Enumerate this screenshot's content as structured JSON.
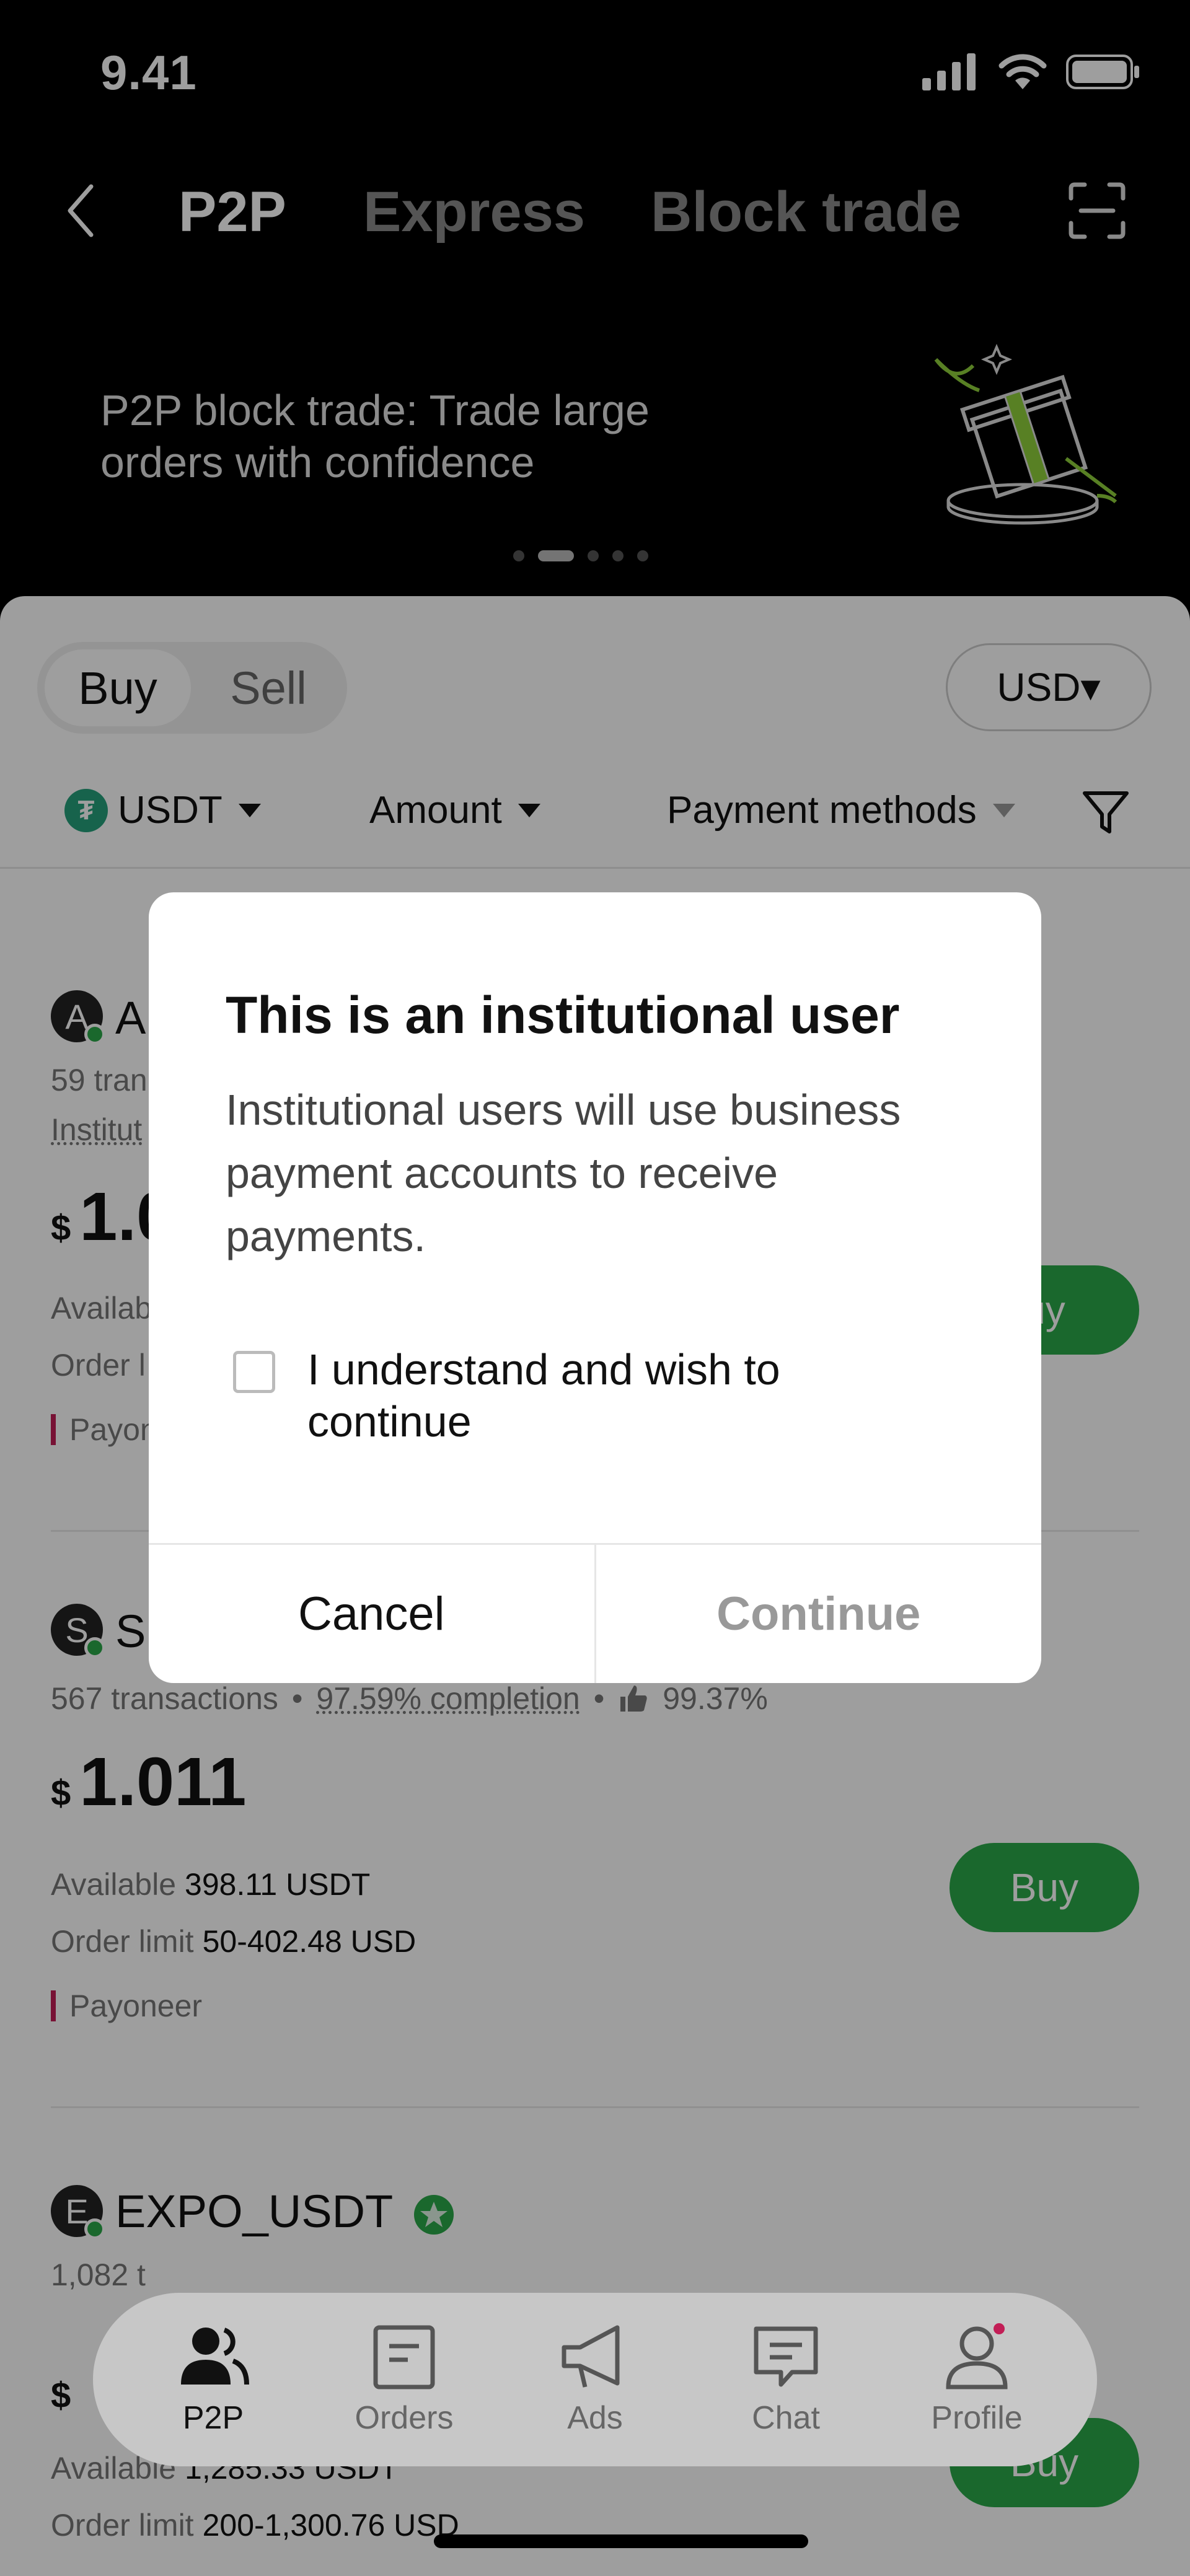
{
  "status_bar": {
    "time": "9.41"
  },
  "nav": {
    "tabs": [
      "P2P",
      "Express",
      "Block trade"
    ]
  },
  "banner": {
    "text": "P2P block trade: Trade large orders with confidence"
  },
  "toggle": {
    "buy": "Buy",
    "sell": "Sell"
  },
  "currency": "USD▾",
  "filters": {
    "coin": "USDT",
    "amount": "Amount",
    "payment": "Payment methods"
  },
  "ads": [
    {
      "avatar": "A",
      "name": "Al",
      "stats_prefix": "59 tran",
      "institutional": "Institut",
      "price_symbol": "$",
      "price": "1.0",
      "available_label": "Availab",
      "order_limit_label": "Order l",
      "payment": "Payon",
      "buy_label": "uy"
    },
    {
      "avatar": "S",
      "name": "Sh",
      "transactions": "567 transactions",
      "completion": "97.59% completion",
      "rating": "99.37%",
      "price_symbol": "$",
      "price": "1.011",
      "available_label": "Available",
      "available_value": "398.11 USDT",
      "order_limit_label": "Order limit",
      "order_limit_value": "50-402.48 USD",
      "payment": "Payoneer",
      "buy_label": "Buy"
    },
    {
      "avatar": "E",
      "name": "EXPO_USDT",
      "stats_partial": "1,082 t",
      "price_symbol": "$",
      "available_label": "Available",
      "available_value": "1,285.33 USDT",
      "order_limit_label": "Order limit",
      "order_limit_value": "200-1,300.76 USD",
      "buy_label": "Buy"
    }
  ],
  "tabbar": {
    "items": [
      {
        "label": "P2P",
        "icon": "users-icon",
        "active": true
      },
      {
        "label": "Orders",
        "icon": "orders-icon",
        "active": false
      },
      {
        "label": "Ads",
        "icon": "megaphone-icon",
        "active": false
      },
      {
        "label": "Chat",
        "icon": "chat-icon",
        "active": false
      },
      {
        "label": "Profile",
        "icon": "person-icon",
        "active": false
      }
    ]
  },
  "dialog": {
    "title": "This is an institutional user",
    "body": "Institutional users will use business payment accounts to receive payments.",
    "checkbox_label": "I understand and wish to continue",
    "checkbox_checked": false,
    "cancel": "Cancel",
    "continue": "Continue"
  },
  "colors": {
    "accent": "#2ba84a",
    "coin": "#26a17b",
    "payoneer": "#c21e56"
  }
}
